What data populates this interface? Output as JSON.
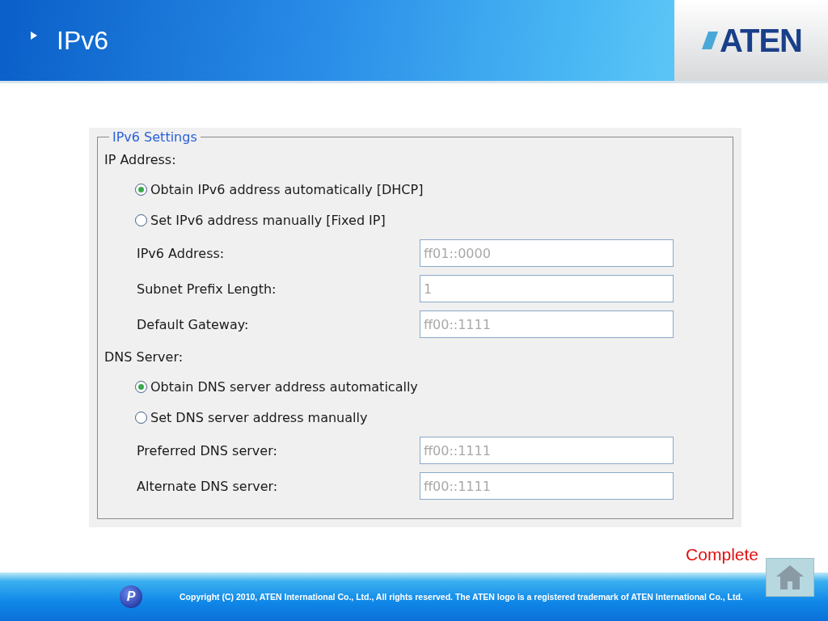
{
  "header": {
    "title": "IPv6",
    "logo": "ATEN"
  },
  "settings": {
    "legend": "IPv6 Settings",
    "sections": [
      {
        "label": "IP Address:",
        "options": [
          {
            "label": "Obtain IPv6 address automatically [DHCP]",
            "selected": true
          },
          {
            "label": "Set IPv6 address manually [Fixed IP]",
            "selected": false
          }
        ],
        "fields": [
          {
            "label": "IPv6 Address:",
            "value": "ff01::0000",
            "disabled": true
          },
          {
            "label": "Subnet Prefix Length:",
            "value": "1",
            "disabled": true
          },
          {
            "label": "Default Gateway:",
            "value": "ff00::1111",
            "disabled": true
          }
        ]
      },
      {
        "label": "DNS Server:",
        "options": [
          {
            "label": "Obtain DNS server address automatically",
            "selected": true
          },
          {
            "label": "Set DNS server address manually",
            "selected": false
          }
        ],
        "fields": [
          {
            "label": "Preferred DNS server:",
            "value": "ff00::1111",
            "disabled": true
          },
          {
            "label": "Alternate DNS server:",
            "value": "ff00::1111",
            "disabled": true
          }
        ]
      }
    ]
  },
  "footer": {
    "complete": "Complete",
    "badge": "P",
    "copyright": "Copyright (C) 2010, ATEN International Co., Ltd., All rights reserved. The ATEN logo is a registered trademark of ATEN International Co., Ltd."
  }
}
